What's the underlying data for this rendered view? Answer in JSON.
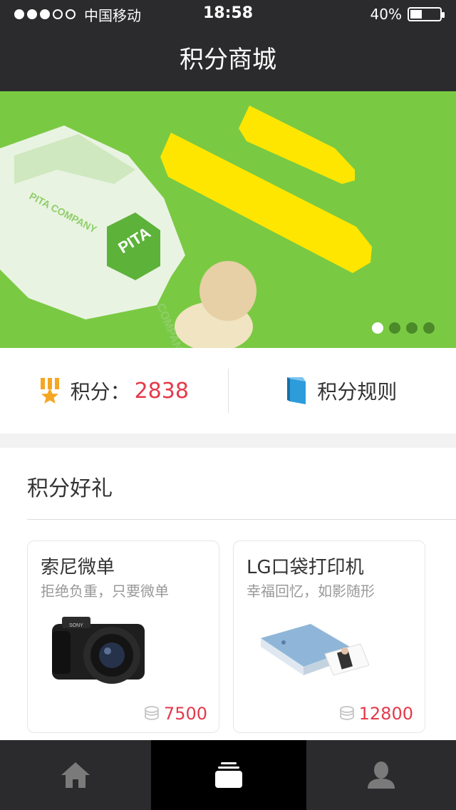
{
  "status_bar": {
    "carrier": "中国移动",
    "time": "18:58",
    "battery": "40%",
    "signal_filled": 3,
    "signal_total": 5
  },
  "header": {
    "title": "积分商城"
  },
  "banner": {
    "slides_total": 4,
    "active_slide": 1,
    "wrap_text": "PITA COMPANY"
  },
  "points": {
    "label": "积分：",
    "value": "2838",
    "rules_label": "积分规则"
  },
  "gifts": {
    "title": "积分好礼",
    "items": [
      {
        "name": "索尼微单",
        "subtitle": "拒绝负重，只要微单",
        "price": "7500",
        "icon": "camera"
      },
      {
        "name": "LG口袋打印机",
        "subtitle": "幸福回忆，如影随形",
        "price": "12800",
        "icon": "printer"
      }
    ]
  },
  "tabs": [
    {
      "name": "home",
      "icon": "home-icon"
    },
    {
      "name": "mall",
      "icon": "cards-icon",
      "active": true
    },
    {
      "name": "profile",
      "icon": "user-icon"
    }
  ],
  "colors": {
    "bar": "#2b2b2d",
    "accent": "#e43a4b",
    "banner_green": "#7ac943",
    "medal_orange": "#f5a623",
    "book_blue": "#2d9cdb"
  }
}
